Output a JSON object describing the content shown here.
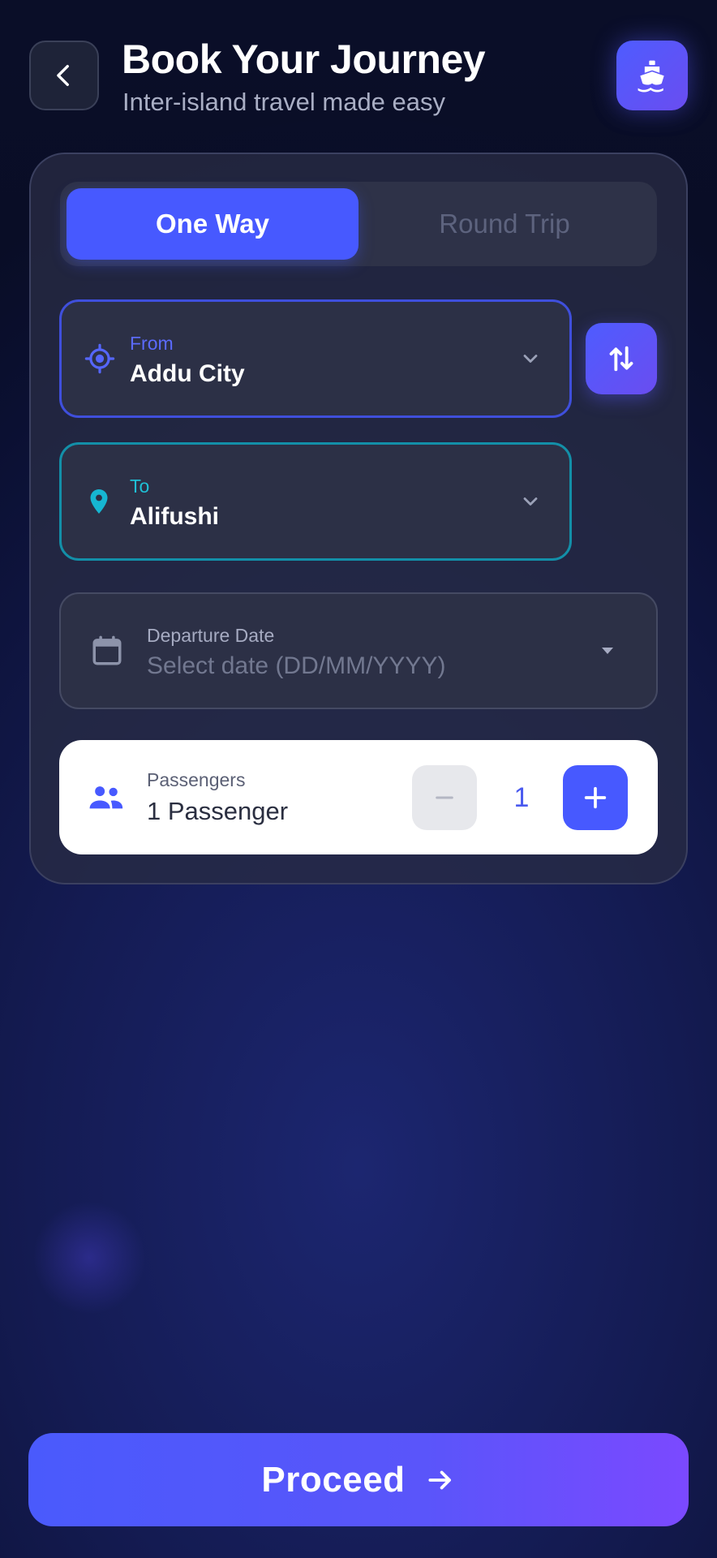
{
  "header": {
    "title": "Book Your Journey",
    "subtitle": "Inter-island travel made easy"
  },
  "trip_type": {
    "options": [
      "One Way",
      "Round Trip"
    ],
    "selected": "One Way"
  },
  "from": {
    "label": "From",
    "value": "Addu City"
  },
  "to": {
    "label": "To",
    "value": "Alifushi"
  },
  "departure": {
    "label": "Departure Date",
    "placeholder": "Select date (DD/MM/YYYY)"
  },
  "passengers": {
    "label": "Passengers",
    "summary": "1 Passenger",
    "count": "1"
  },
  "actions": {
    "proceed_label": "Proceed"
  },
  "colors": {
    "accent": "#4759ff",
    "teal": "#1fc0d6",
    "gradient_end": "#7b49ff"
  },
  "icons": [
    "back-arrow-icon",
    "ship-icon",
    "gps-target-icon",
    "swap-icon",
    "location-pin-icon",
    "calendar-icon",
    "people-icon",
    "minus-icon",
    "plus-icon",
    "arrow-right-icon"
  ]
}
